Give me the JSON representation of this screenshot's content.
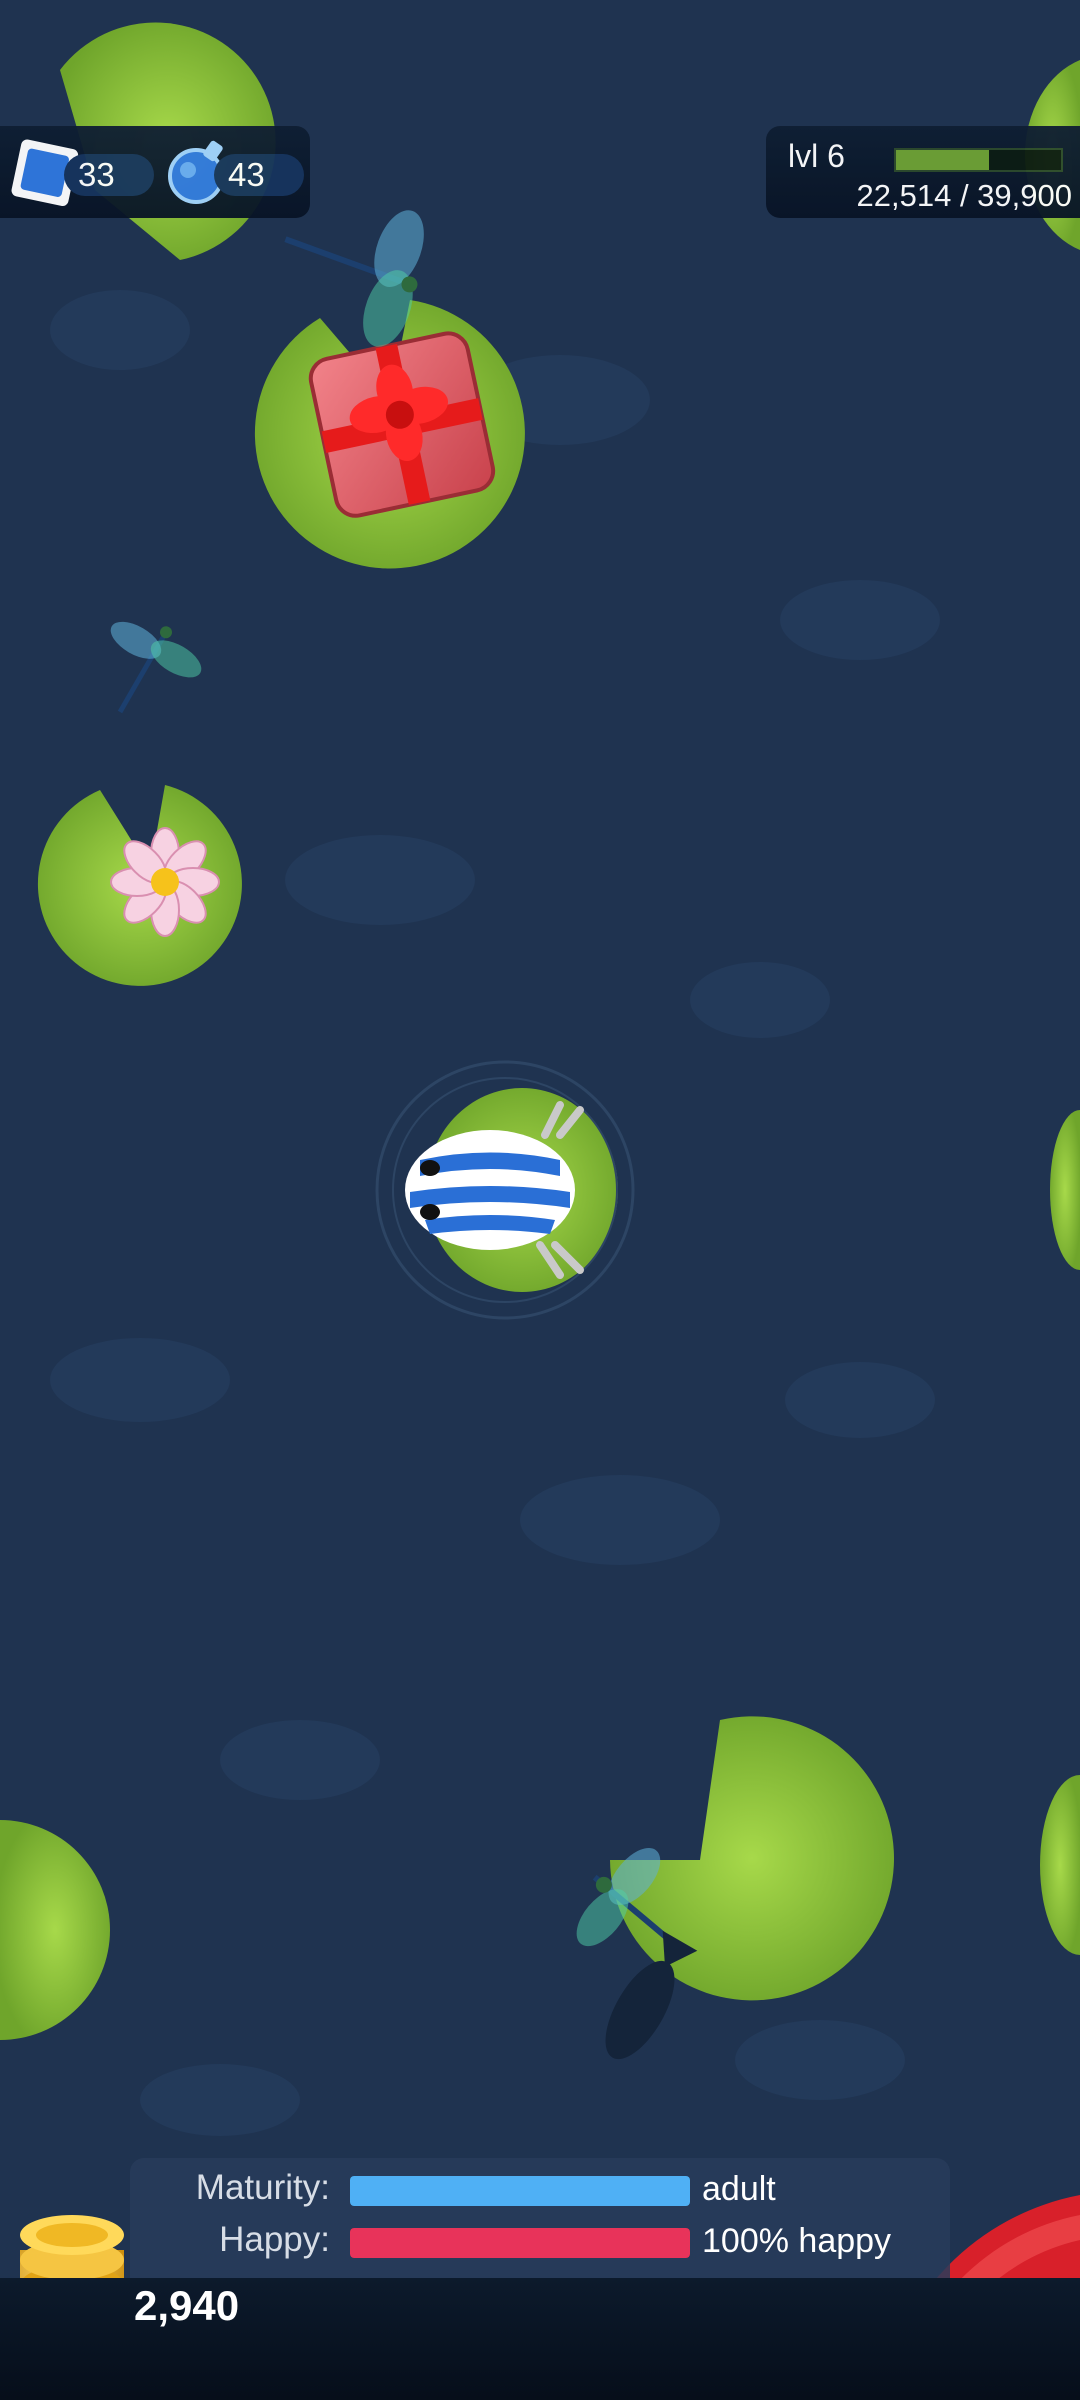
{
  "hud": {
    "stamps_count": "33",
    "potions_count": "43",
    "level_label": "lvl 6",
    "xp_text": "22,514 / 39,900",
    "xp_progress": 0.564
  },
  "stats": {
    "maturity_label": "Maturity:",
    "maturity_value": "adult",
    "maturity_progress": 1.0,
    "happy_label": "Happy:",
    "happy_value": "100% happy",
    "happy_progress": 1.0
  },
  "wallet": {
    "coins": "2,940"
  },
  "colors": {
    "water": "#1f3350",
    "lily_pad": "#8cc63f",
    "maturity_bar": "#4fb0f5",
    "happy_bar": "#e8335a",
    "close_button": "#d8202a"
  },
  "icons": [
    "stamp-icon",
    "potion-icon",
    "gift-box-icon",
    "dragonfly-icon",
    "lotus-flower-icon",
    "frog-icon",
    "fish-shadow-icon",
    "gold-coins-icon",
    "close-icon"
  ]
}
